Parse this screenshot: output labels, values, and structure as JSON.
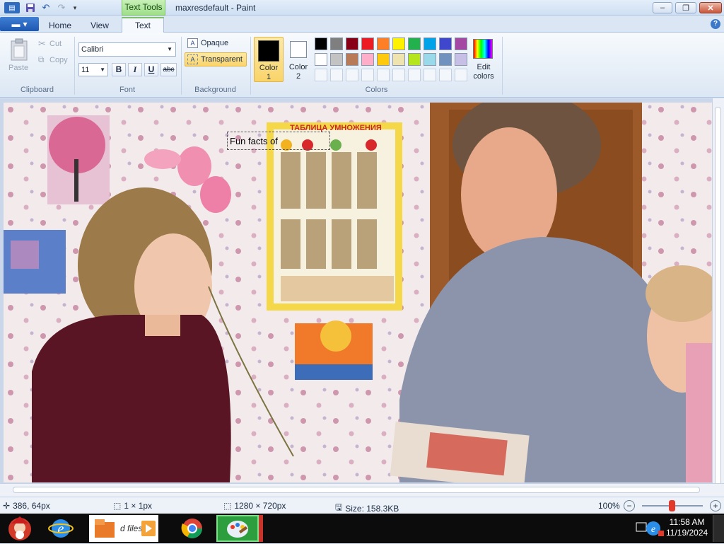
{
  "titlebar": {
    "context_tab": "Text Tools",
    "title": "maxresdefault - Paint",
    "minimize": "‒",
    "restore": "❐",
    "close": "✕"
  },
  "tabs": {
    "file_menu": "▾",
    "home": "Home",
    "view": "View",
    "text": "Text",
    "help": "?"
  },
  "clipboard": {
    "paste": "Paste",
    "cut": "Cut",
    "copy": "Copy",
    "group": "Clipboard"
  },
  "font": {
    "family": "Calibri",
    "size": "11",
    "bold": "B",
    "italic": "I",
    "underline": "U",
    "strike": "abc",
    "group": "Font"
  },
  "background": {
    "opaque": "Opaque",
    "transparent": "Transparent",
    "group": "Background"
  },
  "colors": {
    "color1_label": "Color",
    "color1_num": "1",
    "color2_label": "Color",
    "color2_num": "2",
    "edit_label": "Edit",
    "edit_label2": "colors",
    "group": "Colors",
    "color1": "#000000",
    "color2": "#ffffff",
    "palette_row1": [
      "#000000",
      "#7f7f7f",
      "#880015",
      "#ed1c24",
      "#ff7f27",
      "#fff200",
      "#22b14c",
      "#00a2e8",
      "#3f48cc",
      "#a349a4"
    ],
    "palette_row2": [
      "#ffffff",
      "#c3c3c3",
      "#b97a57",
      "#ffaec9",
      "#ffc90e",
      "#efe4b0",
      "#b5e61d",
      "#99d9ea",
      "#7092be",
      "#c8bfe7"
    ]
  },
  "canvas": {
    "text_box_content": "Fun facts of",
    "poster_title": "ТАБЛИЦА УМНОЖЕНИЯ"
  },
  "status": {
    "cursor_pos": "386, 64px",
    "selection_size": "1 × 1px",
    "image_size": "1280 × 720px",
    "file_size": "Size: 158.3KB",
    "zoom": "100%"
  },
  "taskbar": {
    "files_label": "d files",
    "time": "11:58 AM",
    "date": "11/19/2024"
  }
}
